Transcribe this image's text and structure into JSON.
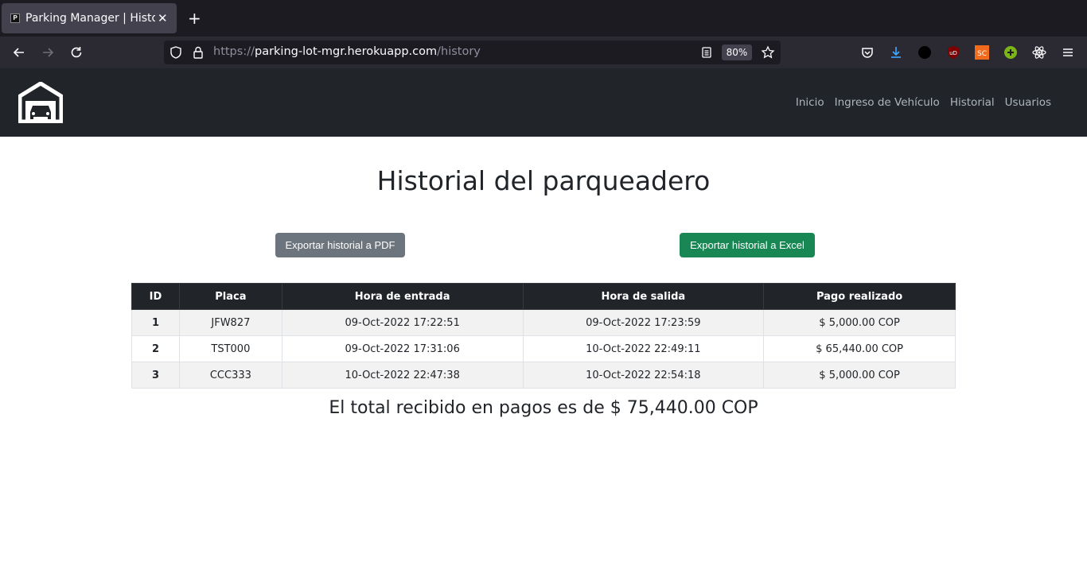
{
  "browser": {
    "tab_title": "Parking Manager | Historial",
    "tab_favicon_letter": "P",
    "url_scheme": "https://",
    "url_host": "parking-lot-mgr.herokuapp.com",
    "url_path": "/history",
    "zoom": "80%",
    "extensions": [
      {
        "name": "pocket-icon",
        "color": "#fbfbfe"
      },
      {
        "name": "download-icon",
        "color": "#3fa9ff"
      },
      {
        "name": "black-circle-extension-icon",
        "color": "#000000"
      },
      {
        "name": "ublock-origin-icon",
        "color": "#800000",
        "label": "uD"
      },
      {
        "name": "sc-extension-icon",
        "color": "#f26a1b",
        "label": "SC"
      },
      {
        "name": "green-plus-extension-icon",
        "color": "#7cb518"
      },
      {
        "name": "react-devtools-icon",
        "color": "#fbfbfe"
      }
    ]
  },
  "site": {
    "nav": [
      {
        "label": "Inicio"
      },
      {
        "label": "Ingreso de Vehículo"
      },
      {
        "label": "Historial"
      },
      {
        "label": "Usuarios"
      }
    ]
  },
  "main": {
    "title": "Historial del parqueadero",
    "export_pdf_label": "Exportar historial a PDF",
    "export_excel_label": "Exportar historial a Excel",
    "table": {
      "headers": [
        "ID",
        "Placa",
        "Hora de entrada",
        "Hora de salida",
        "Pago realizado"
      ],
      "rows": [
        {
          "id": "1",
          "placa": "JFW827",
          "entrada": "09-Oct-2022 17:22:51",
          "salida": "09-Oct-2022 17:23:59",
          "pago": "$ 5,000.00 COP"
        },
        {
          "id": "2",
          "placa": "TST000",
          "entrada": "09-Oct-2022 17:31:06",
          "salida": "10-Oct-2022 22:49:11",
          "pago": "$ 65,440.00 COP"
        },
        {
          "id": "3",
          "placa": "CCC333",
          "entrada": "10-Oct-2022 22:47:38",
          "salida": "10-Oct-2022 22:54:18",
          "pago": "$ 5,000.00 COP"
        }
      ]
    },
    "total_text": "El total recibido en pagos es de $ 75,440.00 COP"
  },
  "colors": {
    "header_bg": "#212529",
    "btn_secondary": "#6c757d",
    "btn_success": "#198754"
  }
}
